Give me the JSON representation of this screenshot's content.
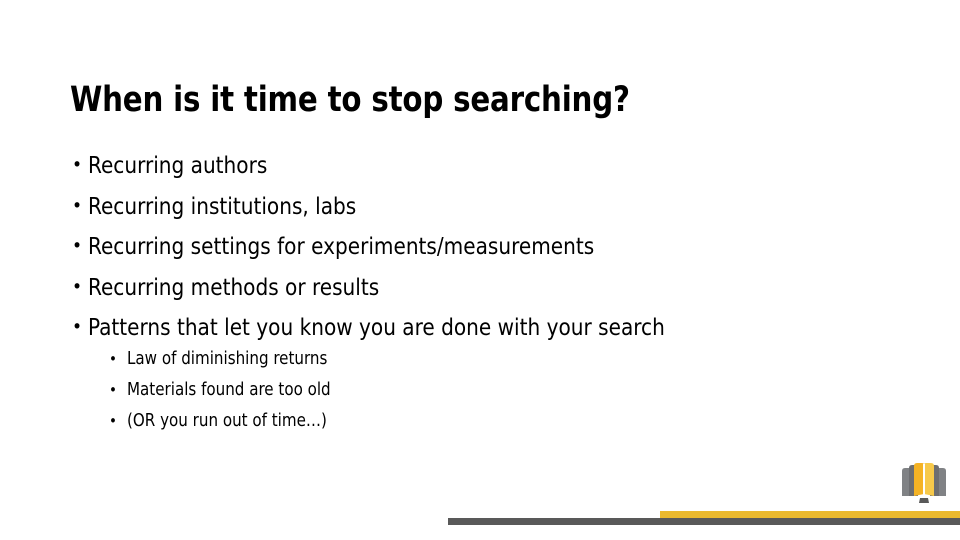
{
  "slide": {
    "title": "When is it time to stop searching?",
    "background_color": "#FFFFFF",
    "text_color": "#000000",
    "bullet_glyph": "•",
    "bullets": [
      {
        "text": "Recurring authors"
      },
      {
        "text": "Recurring institutions, labs"
      },
      {
        "text": "Recurring settings for experiments/measurements"
      },
      {
        "text": "Recurring methods or results"
      },
      {
        "text": "Patterns that let you know you are done with your search"
      }
    ],
    "sub_bullets": [
      {
        "text": "Law of diminishing returns"
      },
      {
        "text": "Materials found are too old"
      },
      {
        "text": "(OR you run out of time…)"
      }
    ]
  },
  "footer": {
    "gold_bar_color": "#EBB92E",
    "gray_bar_color": "#595959"
  },
  "logo": {
    "name": "open-book-logo",
    "page_color": "#F5B324",
    "page_color_light": "#F7C94A",
    "cover_color": "#808285",
    "cover_color_dark": "#6D6E71",
    "gutter_color": "#FFFFFF"
  }
}
